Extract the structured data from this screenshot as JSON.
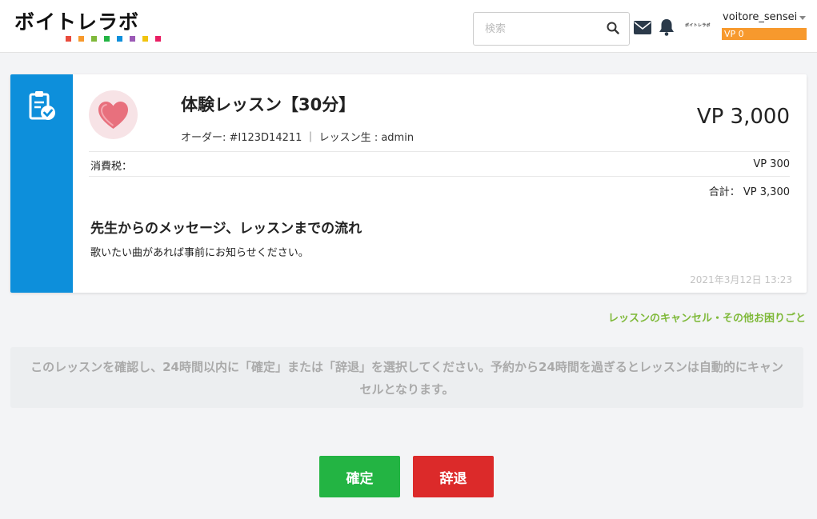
{
  "header": {
    "logo_text": "ボイトレラボ",
    "logo_dot_colors": [
      "#e94b3c",
      "#f7992d",
      "#7fb93a",
      "#23b443",
      "#0d8fdb",
      "#9b59b6",
      "#f1c40f",
      "#e91e63"
    ],
    "search_placeholder": "検索",
    "mini_logo_text": "ボイトレラボ",
    "username": "voitore_sensei",
    "vp_badge": "VP 0"
  },
  "lesson": {
    "title": "体験レッスン【30分】",
    "order_line": "オーダー: #I123D14211 ｜ レッスン生 : admin",
    "price": "VP 3,000",
    "tax_label": "消費税：",
    "tax_value": "VP 300",
    "total": "合計： VP 3,300",
    "message_heading": "先生からのメッセージ、レッスンまでの流れ",
    "message_body": "歌いたい曲があれば事前にお知らせください。",
    "timestamp": "2021年3月12日 13:23"
  },
  "cancel_link": "レッスンのキャンセル・その他お困りごと",
  "notice": "このレッスンを確認し、24時間以内に「確定」または「辞退」を選択してください。予約から24時間を過ぎるとレッスンは自動的にキャンセルとなります。",
  "buttons": {
    "confirm": "確定",
    "decline": "辞退"
  },
  "colors": {
    "accent_blue": "#0d8fdb",
    "confirm_green": "#23b443",
    "decline_red": "#dc2a2a",
    "vp_orange": "#f7992d",
    "link_green": "#7fb93a"
  }
}
